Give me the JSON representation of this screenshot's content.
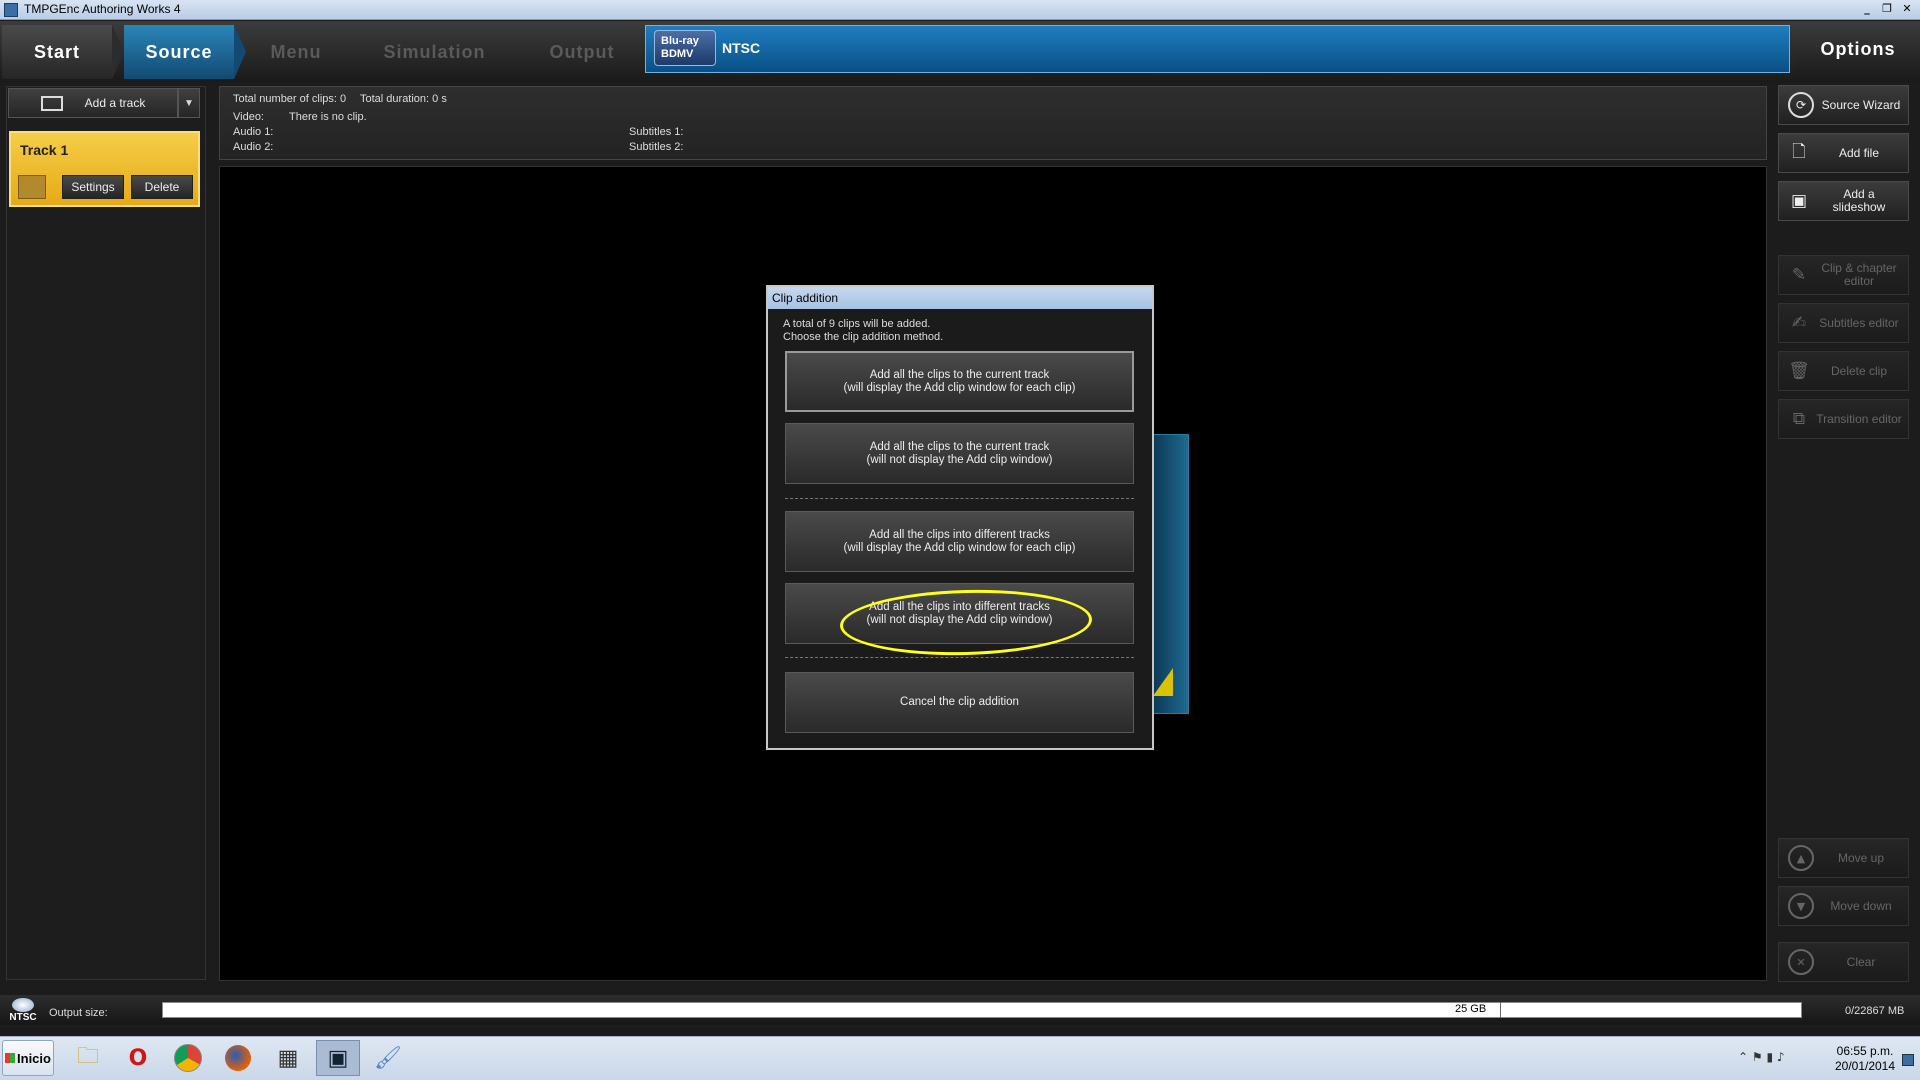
{
  "window": {
    "title": "TMPGEnc Authoring Works 4"
  },
  "nav": {
    "steps": [
      "Start",
      "Source",
      "Menu",
      "Simulation",
      "Output"
    ],
    "disc_logo": "Blu-ray BDMV",
    "disc_format": "NTSC",
    "options_label": "Options"
  },
  "left": {
    "add_track_label": "Add a track",
    "track_name": "Track 1",
    "settings_label": "Settings",
    "delete_label": "Delete"
  },
  "info": {
    "total_clips": "Total number of clips: 0",
    "total_duration": "Total duration: 0 s",
    "video_label": "Video:",
    "video_value": "There is no clip.",
    "audio1": "Audio 1:",
    "audio2": "Audio 2:",
    "subs1": "Subtitles 1:",
    "subs2": "Subtitles 2:"
  },
  "right": {
    "source_wizard": "Source Wizard",
    "add_file": "Add file",
    "add_slideshow": "Add a slideshow",
    "clip_chapter_editor": "Clip & chapter editor",
    "subtitles_editor": "Subtitles editor",
    "delete_clip": "Delete clip",
    "transition_editor": "Transition editor",
    "move_up": "Move up",
    "move_down": "Move down",
    "clear": "Clear"
  },
  "dialog": {
    "title": "Clip addition",
    "line1": "A total of 9 clips will be added.",
    "line2": "Choose the clip addition method.",
    "opt1_l1": "Add all the clips to the current track",
    "opt1_l2": "(will display the Add clip window for each clip)",
    "opt2_l1": "Add all the clips to the current track",
    "opt2_l2": "(will not display the Add clip window)",
    "opt3_l1": "Add all the clips into different tracks",
    "opt3_l2": "(will display the Add clip window for each clip)",
    "opt4_l1": "Add all the clips into different tracks",
    "opt4_l2": "(will not display the Add clip window)",
    "cancel": "Cancel the clip addition"
  },
  "status": {
    "ntsc": "NTSC",
    "output_size_label": "Output size:",
    "capacity": "25 GB",
    "usage": "0/22867  MB"
  },
  "taskbar": {
    "start_label": "Inicio",
    "time": "06:55 p.m.",
    "date": "20/01/2014"
  },
  "colors": {
    "accent": "#1f7ec0",
    "track": "#f0c030",
    "highlight": "#ffff1a"
  },
  "icons": [
    "folder-icon",
    "opera-icon",
    "chrome-icon",
    "firefox-icon",
    "calculator-icon",
    "tmpgenc-icon",
    "paint-icon"
  ]
}
